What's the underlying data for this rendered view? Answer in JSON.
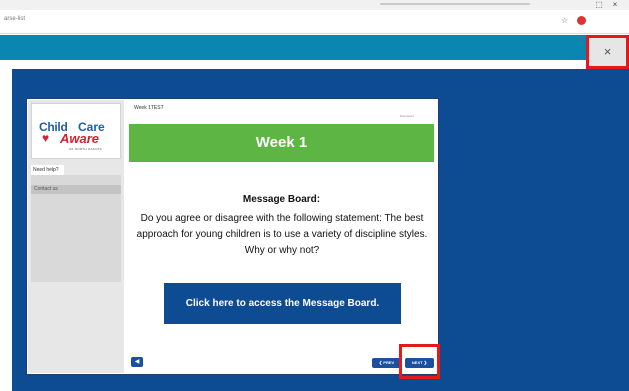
{
  "browser": {
    "url": "arse-list",
    "star_icon": "☆",
    "window_buttons": [
      "⬚",
      "×"
    ]
  },
  "modal": {
    "close_label": "×"
  },
  "sidebar": {
    "logo_child": "Child",
    "logo_care": "Care",
    "logo_aware": "Aware",
    "logo_sub": "OF NORTH DAKOTA",
    "help_tab": "Need help?",
    "contact_item": "Contact us"
  },
  "slide": {
    "week_label": "Week 1TEST",
    "corner_text": "Dismissed",
    "banner_title": "Week 1",
    "mb_title": "Message Board:",
    "mb_body": "Do you agree or disagree with the following statement: The best approach for young children is to use a variety of discipline styles. Why or why not?",
    "mb_link": "Click here to access the Message Board."
  },
  "controls": {
    "audio_icon": "◀",
    "prev_label": "❮ PREV",
    "next_label": "NEXT ❯"
  },
  "colors": {
    "teal": "#0a86b0",
    "navy": "#0d4b92",
    "green": "#5db544",
    "highlight": "#e21a1a"
  }
}
